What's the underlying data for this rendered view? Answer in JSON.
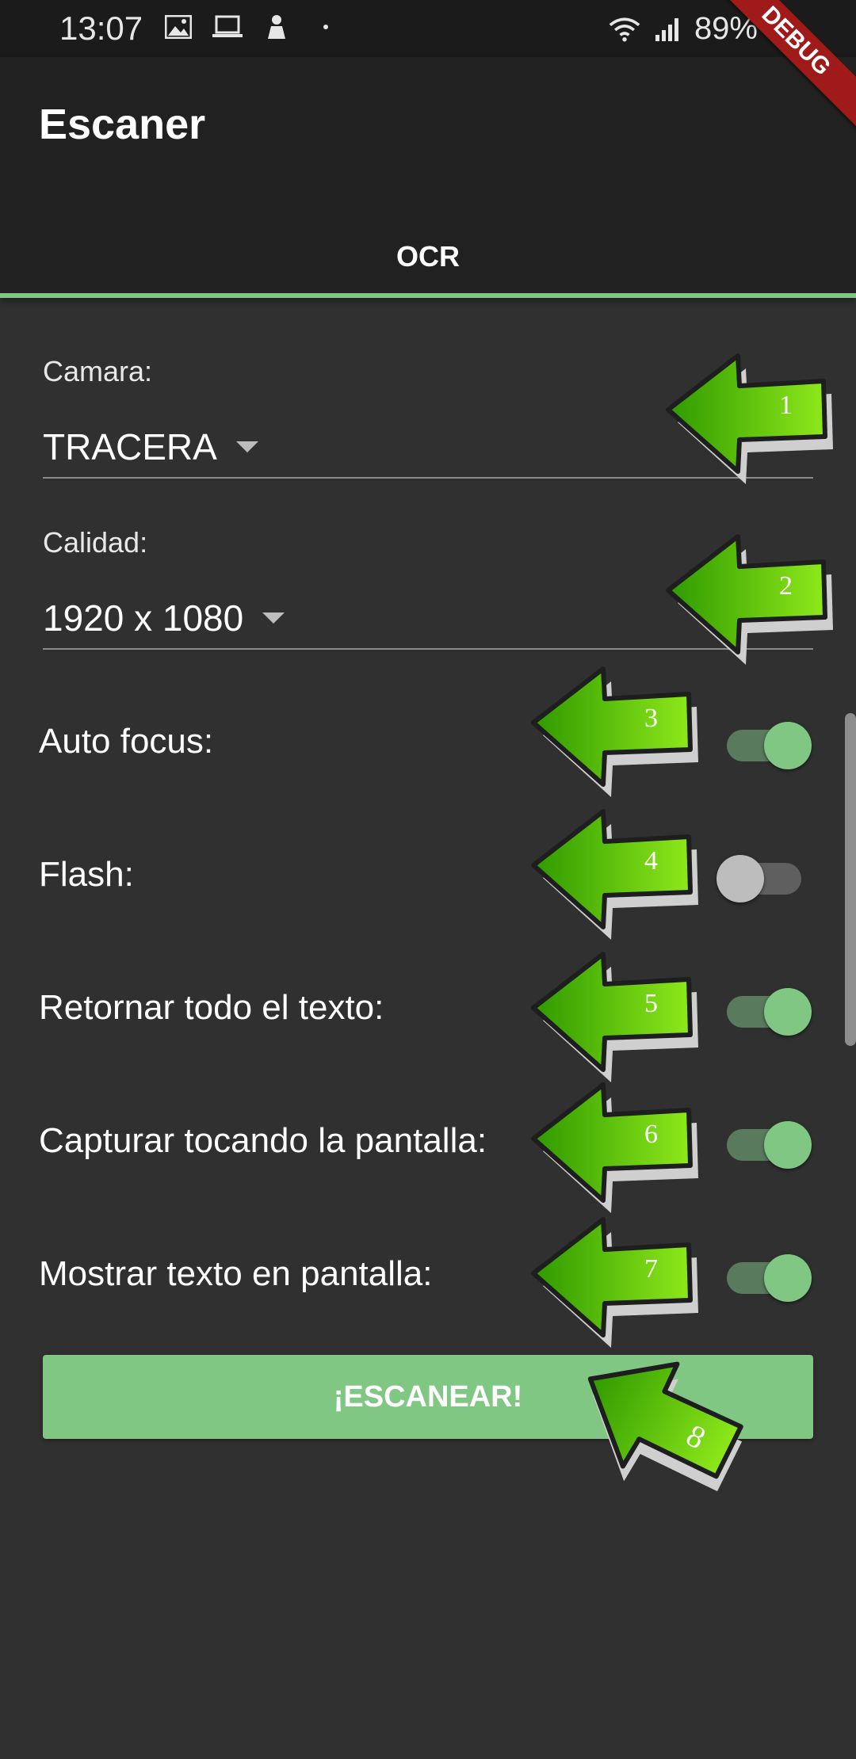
{
  "status_bar": {
    "time": "13:07",
    "battery": "89%",
    "icons_left": [
      "image-icon",
      "laptop-icon",
      "notification-icon",
      "dot-icon"
    ],
    "icons_right": [
      "wifi-icon",
      "signal-icon",
      "battery-icon"
    ]
  },
  "debug_banner": "DEBUG",
  "appbar": {
    "title": "Escaner",
    "tabs": [
      {
        "label": "OCR",
        "selected": true
      }
    ]
  },
  "form": {
    "camera": {
      "label": "Camara:",
      "value": "TRACERA"
    },
    "quality": {
      "label": "Calidad:",
      "value": "1920 x 1080"
    },
    "switches": [
      {
        "label": "Auto focus:",
        "on": true
      },
      {
        "label": "Flash:",
        "on": false
      },
      {
        "label": "Retornar todo el texto:",
        "on": true
      },
      {
        "label": "Capturar tocando la pantalla:",
        "on": true
      },
      {
        "label": "Mostrar texto en pantalla:",
        "on": true
      }
    ],
    "scan_button": "¡ESCANEAR!"
  },
  "annotations": [
    "1",
    "2",
    "3",
    "4",
    "5",
    "6",
    "7",
    "8"
  ],
  "colors": {
    "accent": "#81c784",
    "appbar_bg": "#212121",
    "body_bg": "#303030",
    "annotation_arrow": "#5cc10a",
    "debug_banner": "#a01a1a"
  }
}
